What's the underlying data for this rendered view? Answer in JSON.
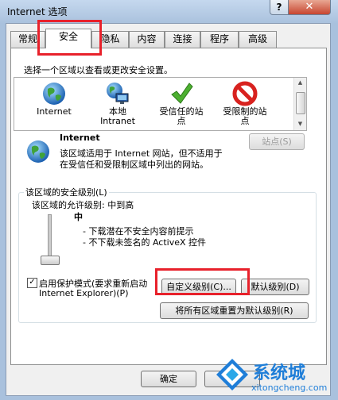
{
  "window": {
    "title": "Internet 选项",
    "help_label": "?",
    "close_label": "✕"
  },
  "tabs": [
    {
      "label": "常规"
    },
    {
      "label": "安全"
    },
    {
      "label": "隐私"
    },
    {
      "label": "内容"
    },
    {
      "label": "连接"
    },
    {
      "label": "程序"
    },
    {
      "label": "高级"
    }
  ],
  "security": {
    "prompt": "选择一个区域以查看或更改安全设置。",
    "zones": [
      {
        "label": "Internet",
        "icon": "globe-icon"
      },
      {
        "label": "本地\nIntranet",
        "icon": "intranet-icon"
      },
      {
        "label": "受信任的站\n点",
        "icon": "checkmark-icon"
      },
      {
        "label": "受限制的站\n点",
        "icon": "no-entry-icon"
      }
    ],
    "selected_zone_name": "Internet",
    "description_line1": "该区域适用于 Internet 网站，但不适用于",
    "description_line2": "在受信任和受限制区域中列出的网站。",
    "sites_button": "站点(S)",
    "level_group_label": "该区域的安全级别(L)",
    "allowed_levels": "该区域的允许级别: 中到高",
    "level_name": "中",
    "bullet1": "- 下载潜在不安全内容前提示",
    "bullet2": "- 不下载未签名的 ActiveX 控件",
    "protected_mode_line1": "启用保护模式(要求重新启动",
    "protected_mode_line2": "Internet Explorer)(P)",
    "protected_mode_checked": true,
    "custom_level_button": "自定义级别(C)...",
    "default_level_button": "默认级别(D)",
    "reset_all_button": "将所有区域重置为默认级别(R)"
  },
  "footer": {
    "ok_button": "确定",
    "cancel_button": "取消"
  },
  "watermark": {
    "brand": "系统城",
    "url": "xitongcheng.com"
  },
  "colors": {
    "highlight_box": "#e8212b",
    "selected_tab_bg": "#ffffff"
  }
}
